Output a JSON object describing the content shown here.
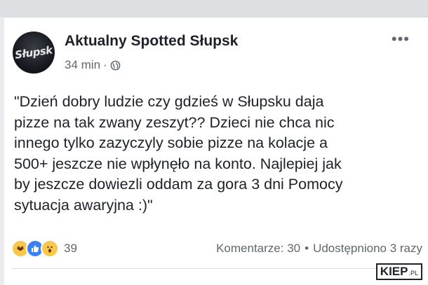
{
  "post": {
    "page_name": "Aktualny Spotted Słupsk",
    "avatar_text": "Słupsk",
    "time": "34 min",
    "time_separator": "·",
    "more_label": "•••",
    "text_lines": [
      "\"Dzień dobry ludzie czy gdzieś w Słupsku daja",
      "pizze na tak zwany zeszyt?? Dzieci nie chca nic",
      "innego tylko zazyczyly sobie pizze na kolacje a",
      "500+ jeszcze nie wpłynęło na konto. Najlepiej jak",
      "by jeszcze dowiezli oddam za gora 3 dni Pomocy",
      "sytuacja awaryjna :)\""
    ]
  },
  "footer": {
    "reaction_icons": [
      "haha-icon",
      "like-icon",
      "wow-icon"
    ],
    "reaction_count": "39",
    "comments": "Komentarze: 30",
    "separator": "•",
    "shares": "Udostępniono 3 razy"
  },
  "watermark": {
    "main": "KIEP",
    "suffix": ".PL"
  },
  "colors": {
    "background": "#e9ebee",
    "text": "#1d2129",
    "muted": "#606770",
    "like_blue": "#3b82f0",
    "emoji_yellow": "#f7c84b"
  }
}
